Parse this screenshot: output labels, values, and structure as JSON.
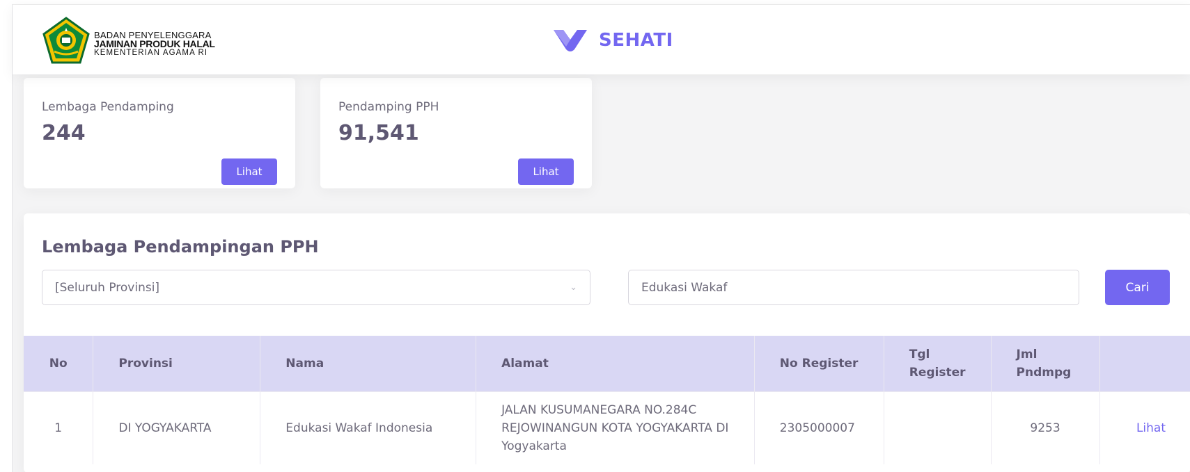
{
  "header": {
    "logo_lines": [
      "BADAN PENYELENGGARA",
      "JAMINAN PRODUK HALAL",
      "KEMENTERIAN AGAMA RI"
    ],
    "brand_name": "SEHATI"
  },
  "stats": [
    {
      "label": "Lembaga Pendamping",
      "value": "244",
      "button": "Lihat"
    },
    {
      "label": "Pendamping PPH",
      "value": "91,541",
      "button": "Lihat"
    }
  ],
  "main": {
    "title": "Lembaga Pendampingan PPH",
    "province_select": {
      "value": "[Seluruh Provinsi]"
    },
    "search": {
      "value": "Edukasi Wakaf"
    },
    "search_button": "Cari",
    "table": {
      "columns": [
        "No",
        "Provinsi",
        "Nama",
        "Alamat",
        "No Register",
        "Tgl Register",
        "Jml Pndmpg",
        ""
      ],
      "rows": [
        {
          "no": "1",
          "provinsi": "DI YOGYAKARTA",
          "nama": "Edukasi Wakaf Indonesia",
          "alamat": "JALAN KUSUMANEGARA NO.284C REJOWINANGUN KOTA YOGYAKARTA DI Yogyakarta",
          "no_register": "2305000007",
          "tgl_register": "",
          "jml_pndmpg": "9253",
          "action": "Lihat"
        }
      ]
    }
  },
  "colors": {
    "primary": "#7367f0",
    "table_header": "#d9d7f4",
    "heading": "#5e5873"
  }
}
